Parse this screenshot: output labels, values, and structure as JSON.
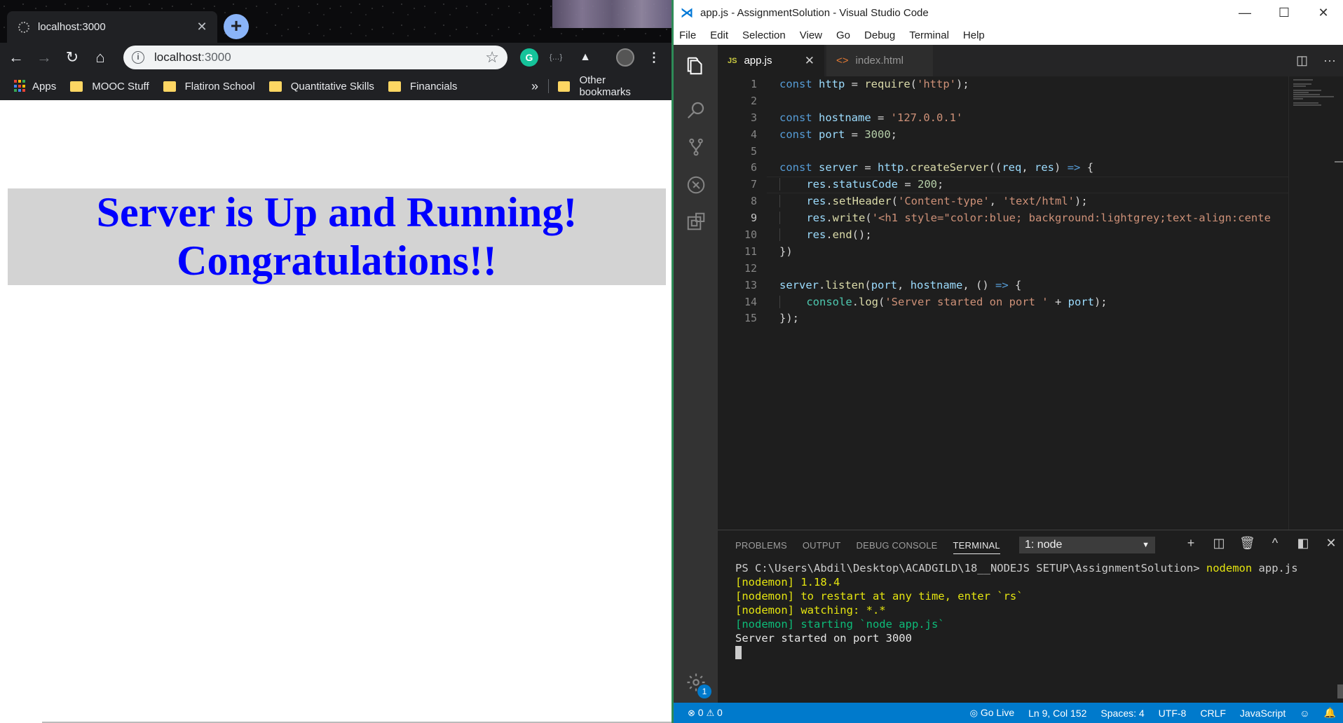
{
  "browser": {
    "tab": {
      "title": "localhost:3000",
      "close": "✕"
    },
    "new_tab": "+",
    "nav": {
      "back": "←",
      "forward": "→",
      "reload": "↻",
      "home": "⌂"
    },
    "omnibox": {
      "host": "localhost",
      "rest": ":3000",
      "star": "☆",
      "info": "i"
    },
    "extensions": [
      "G",
      "{…}",
      "▲",
      "⋮"
    ],
    "bookmarks": [
      {
        "label": "Apps",
        "icon": "apps-grid-icon"
      },
      {
        "label": "MOOC Stuff",
        "icon": "folder-icon"
      },
      {
        "label": "Flatiron School",
        "icon": "folder-icon"
      },
      {
        "label": "Quantitative Skills",
        "icon": "folder-icon"
      },
      {
        "label": "Financials",
        "icon": "folder-icon"
      }
    ],
    "bookmarks_overflow": "»",
    "other_bookmarks": "Other bookmarks",
    "page": {
      "heading_line1": "Server is Up and Running!",
      "heading_line2": "Congratulations!!",
      "heading_color": "#0000ff",
      "heading_background": "#d3d3d3"
    }
  },
  "vscode": {
    "window_title": "app.js - AssignmentSolution - Visual Studio Code",
    "window_controls": {
      "minimize": "—",
      "maximize": "☐",
      "close": "✕"
    },
    "menu": [
      "File",
      "Edit",
      "Selection",
      "View",
      "Go",
      "Debug",
      "Terminal",
      "Help"
    ],
    "tabs": [
      {
        "label": "app.js",
        "icon": "JS",
        "active": true,
        "close": "✕"
      },
      {
        "label": "index.html",
        "icon": "<>",
        "active": false
      }
    ],
    "tab_actions": [
      "◫",
      "···"
    ],
    "current_line": 9,
    "line_numbers": [
      "1",
      "2",
      "3",
      "4",
      "5",
      "6",
      "7",
      "8",
      "9",
      "10",
      "11",
      "12",
      "13",
      "14",
      "15"
    ],
    "panel": {
      "tabs": [
        "PROBLEMS",
        "OUTPUT",
        "DEBUG CONSOLE",
        "TERMINAL"
      ],
      "active_tab": "TERMINAL",
      "terminal_select": "1: node",
      "actions": [
        "+",
        "◫",
        "🗑",
        "^",
        "◧",
        "✕"
      ],
      "terminal_lines": [
        {
          "prompt": "PS C:\\Users\\Abdil\\Desktop\\ACADGILD\\18__NODEJS SETUP\\AssignmentSolution> ",
          "cmd": "nodemon",
          "args": " app.js"
        },
        {
          "text": "[nodemon] 1.18.4",
          "color": "yellow"
        },
        {
          "text": "[nodemon] to restart at any time, enter `rs`",
          "color": "yellow"
        },
        {
          "text": "[nodemon] watching: *.*",
          "color": "yellow"
        },
        {
          "text": "[nodemon] starting `node app.js`",
          "color": "green"
        },
        {
          "text": "Server started on port 3000",
          "color": "white"
        }
      ]
    },
    "status": {
      "errors": "0",
      "warnings": "0",
      "go_live": "Go Live",
      "position": "Ln 9, Col 152",
      "spaces": "Spaces: 4",
      "encoding": "UTF-8",
      "eol": "CRLF",
      "language": "JavaScript",
      "feedback": "☺",
      "bell": "🔔"
    },
    "settings_badge": "1",
    "colors": {
      "accent": "#007acc",
      "activity_bar": "#333333",
      "editor_bg": "#1e1e1e"
    }
  }
}
